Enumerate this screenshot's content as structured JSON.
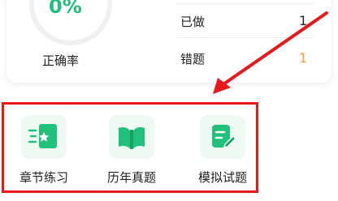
{
  "stats": {
    "accuracy_value": "0%",
    "accuracy_label": "正确率",
    "done_label": "已做",
    "done_value": "1",
    "wrong_label": "错题",
    "wrong_value": "1"
  },
  "entries": [
    {
      "label": "章节练习",
      "icon": "chapter-practice-icon"
    },
    {
      "label": "历年真题",
      "icon": "open-book-icon"
    },
    {
      "label": "模拟试题",
      "icon": "pencil-doc-icon"
    }
  ],
  "colors": {
    "accent": "#1fbf7a",
    "wrong_count": "#f29b38",
    "annotation": "#e8171a"
  }
}
